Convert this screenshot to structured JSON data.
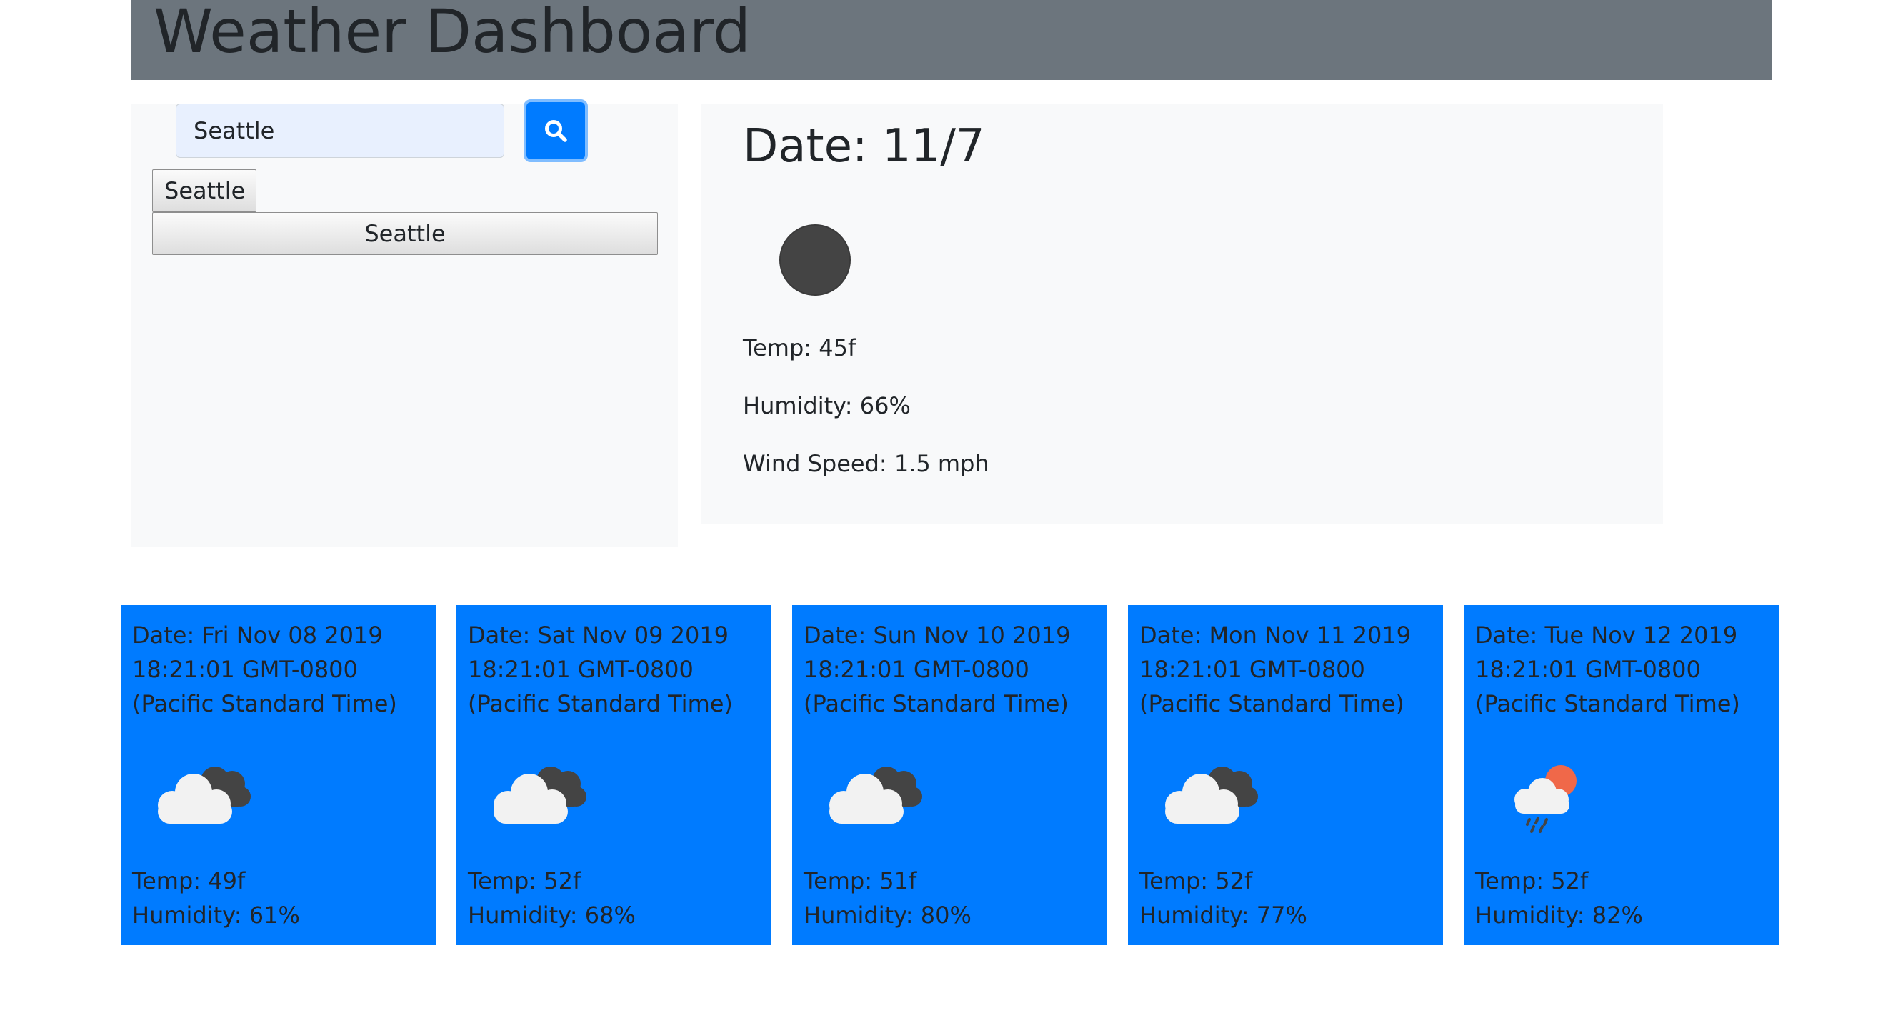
{
  "header": {
    "title": "Weather Dashboard"
  },
  "search": {
    "value": "Seattle",
    "button_icon": "search-icon"
  },
  "history": [
    {
      "label": "Seattle"
    },
    {
      "label": "Seattle"
    }
  ],
  "current": {
    "date": "Date: 11/7",
    "icon": "moon-icon",
    "temp": "Temp: 45f",
    "humidity": "Humidity: 66%",
    "wind": "Wind Speed: 1.5 mph"
  },
  "forecast": [
    {
      "date": "Date: Fri Nov 08 2019 18:21:01 GMT-0800 (Pacific Standard Time)",
      "icon": "broken-clouds-icon",
      "temp": "Temp: 49f",
      "humidity": "Humidity: 61%"
    },
    {
      "date": "Date: Sat Nov 09 2019 18:21:01 GMT-0800 (Pacific Standard Time)",
      "icon": "broken-clouds-icon",
      "temp": "Temp: 52f",
      "humidity": "Humidity: 68%"
    },
    {
      "date": "Date: Sun Nov 10 2019 18:21:01 GMT-0800 (Pacific Standard Time)",
      "icon": "broken-clouds-icon",
      "temp": "Temp: 51f",
      "humidity": "Humidity: 80%"
    },
    {
      "date": "Date: Mon Nov 11 2019 18:21:01 GMT-0800 (Pacific Standard Time)",
      "icon": "broken-clouds-icon",
      "temp": "Temp: 52f",
      "humidity": "Humidity: 77%"
    },
    {
      "date": "Date: Tue Nov 12 2019 18:21:01 GMT-0800 (Pacific Standard Time)",
      "icon": "rain-sun-icon",
      "temp": "Temp: 52f",
      "humidity": "Humidity: 82%"
    }
  ],
  "colors": {
    "header_bg": "#6c757d",
    "primary": "#007bff",
    "panel_bg": "#f8f9fa",
    "text": "#212529"
  }
}
